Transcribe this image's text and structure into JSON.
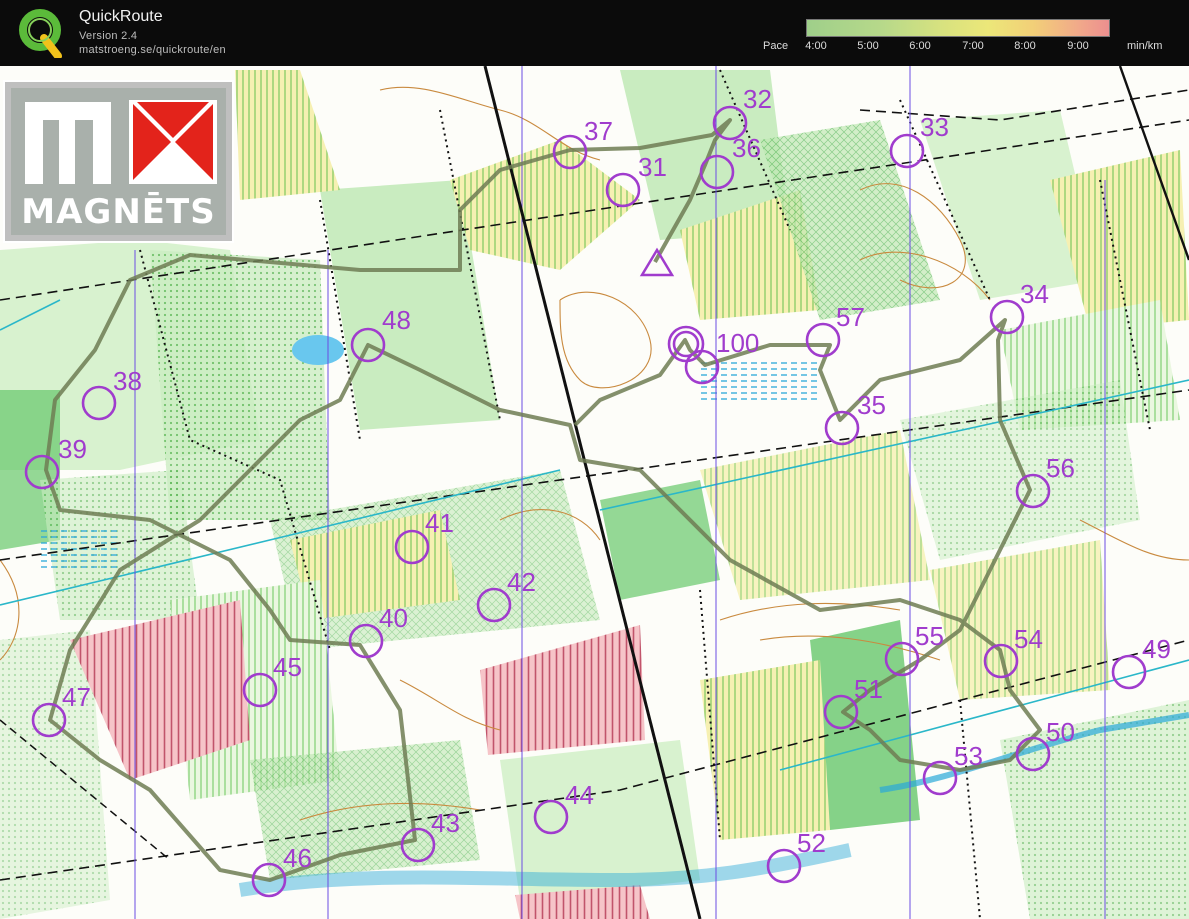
{
  "app": {
    "title": "QuickRoute",
    "version": "Version 2.4",
    "url": "matstroeng.se/quickroute/en"
  },
  "pace_legend": {
    "label": "Pace",
    "ticks": [
      "4:00",
      "5:00",
      "6:00",
      "7:00",
      "8:00",
      "9:00"
    ],
    "unit": "min/km",
    "colors": [
      "#9fcf8a",
      "#d8e27f",
      "#f2cf78",
      "#ec8f8f"
    ]
  },
  "sponsor_logo": {
    "text": "MAGNĒTS",
    "colors": {
      "background": "#a9b0ab",
      "accent": "#e3231b"
    }
  },
  "course_color": "#a03ccd",
  "route_color": "#6e7d54",
  "start_marker": "triangle",
  "controls": [
    {
      "number": "31",
      "label": "31"
    },
    {
      "number": "32",
      "label": "32"
    },
    {
      "number": "33",
      "label": "33"
    },
    {
      "number": "34",
      "label": "34"
    },
    {
      "number": "35",
      "label": "35"
    },
    {
      "number": "36",
      "label": "36"
    },
    {
      "number": "37",
      "label": "37"
    },
    {
      "number": "38",
      "label": "38"
    },
    {
      "number": "39",
      "label": "39"
    },
    {
      "number": "40",
      "label": "40"
    },
    {
      "number": "41",
      "label": "41"
    },
    {
      "number": "42",
      "label": "42"
    },
    {
      "number": "43",
      "label": "43"
    },
    {
      "number": "44",
      "label": "44"
    },
    {
      "number": "45",
      "label": "45"
    },
    {
      "number": "46",
      "label": "46"
    },
    {
      "number": "47",
      "label": "47"
    },
    {
      "number": "48",
      "label": "48"
    },
    {
      "number": "49",
      "label": "49"
    },
    {
      "number": "50",
      "label": "50"
    },
    {
      "number": "51",
      "label": "51"
    },
    {
      "number": "52",
      "label": "52"
    },
    {
      "number": "53",
      "label": "53"
    },
    {
      "number": "54",
      "label": "54"
    },
    {
      "number": "55",
      "label": "55"
    },
    {
      "number": "56",
      "label": "56"
    },
    {
      "number": "57",
      "label": "57"
    },
    {
      "number": "100",
      "label": "100"
    }
  ]
}
